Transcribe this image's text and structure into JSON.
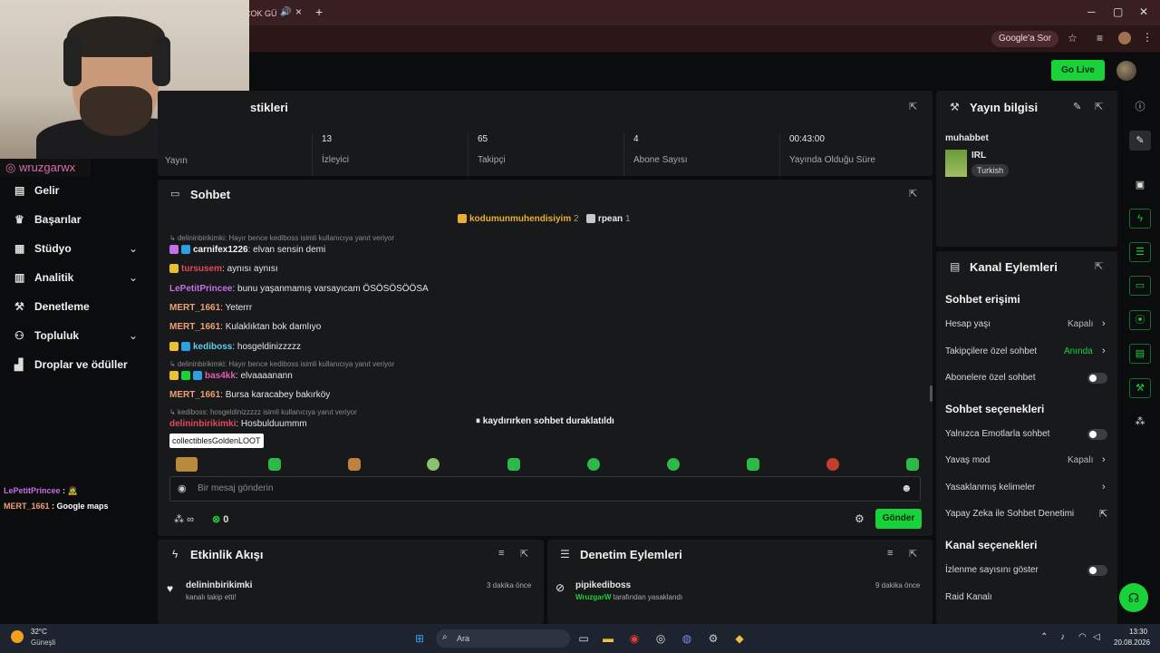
{
  "browser": {
    "tab_title": "ÇOK GÜ",
    "tab_audio_icon": "speaker-icon",
    "tab_close": "×",
    "new_tab": "+",
    "google_sor": "Google'a Sor",
    "win_min": "─",
    "win_max": "▢",
    "win_close": "✕"
  },
  "webcam": {
    "instagram_handle": "wruzgarwx"
  },
  "topbar": {
    "go_live": "Go Live"
  },
  "sidebar": {
    "items": [
      {
        "label": "Gelir",
        "icon": "income-icon"
      },
      {
        "label": "Başarılar",
        "icon": "trophy-icon"
      },
      {
        "label": "Stüdyo",
        "icon": "studio-icon"
      },
      {
        "label": "Analitik",
        "icon": "analytics-icon"
      },
      {
        "label": "Denetleme",
        "icon": "moderation-icon"
      },
      {
        "label": "Topluluk",
        "icon": "community-icon"
      },
      {
        "label": "Droplar ve ödüller",
        "icon": "drops-icon"
      }
    ]
  },
  "external_chat": [
    {
      "user": "LePetitPrincee",
      "sep": " : ",
      "text": "🧟"
    },
    {
      "user": "MERT_1661",
      "sep": " : ",
      "text": "Google maps"
    }
  ],
  "stats_panel": {
    "title": "stikleri",
    "stats": [
      {
        "value": "",
        "label": "Yayın"
      },
      {
        "value": "13",
        "label": "İzleyici"
      },
      {
        "value": "65",
        "label": "Takipçi"
      },
      {
        "value": "4",
        "label": "Abone Sayısı"
      },
      {
        "value": "00:43:00",
        "label": "Yayında Olduğu Süre"
      }
    ]
  },
  "chat": {
    "title": "Sohbet",
    "pinned": [
      {
        "user": "kodumunmuhendisiyim",
        "count": "2"
      },
      {
        "user": "rpean",
        "count": "1"
      }
    ],
    "messages": [
      {
        "reply": "delininbirikimki: Hayır bence kediboss isimli kullanıcıya yanıt veriyor"
      },
      {
        "user": "carnifex1226",
        "text": ": elvan sensin demi",
        "color": "#f2f2f2"
      },
      {
        "user": "tursusem",
        "text": ": aynısı aynısı",
        "color": "#e04a5b"
      },
      {
        "user": "LePetitPrincee",
        "text": ": bunu yaşanmamış varsayıcam ÖSÖSÖSÖÖSA",
        "color": "#c86ee8"
      },
      {
        "user": "MERT_1661",
        "text": ": Yeterrr",
        "color": "#f0a070"
      },
      {
        "user": "MERT_1661",
        "text": ": Kulaklıktan bok damlıyo",
        "color": "#f0a070"
      },
      {
        "user": "kediboss",
        "text": ": hosgeldinizzzzz",
        "color": "#5ad0e8"
      },
      {
        "reply": "delininbirikimki: Hayır bence kediboss isimli kullanıcıya yanıt veriyor"
      },
      {
        "user": "bas4kk",
        "text": ": elvaaaanann",
        "color": "#e85ab0"
      },
      {
        "user": "MERT_1661",
        "text": ": Bursa karacabey bakırköy",
        "color": "#f0a070"
      },
      {
        "reply": "kediboss: hosgeldinizzzzz isimli kullanıcıya yanıt veriyor"
      },
      {
        "user": "delininbirikimki",
        "text": ": Hosbulduummm",
        "color": "#e04a5b"
      }
    ],
    "paused_notice": "kaydırırken sohbet duraklatıldı",
    "tooltip": "collectiblesGoldenLOOT",
    "input_placeholder": "Bir mesaj gönderin",
    "points_label": "∞",
    "kick_points": "0",
    "send_label": "Gönder"
  },
  "activity": {
    "title": "Etkinlik Akışı",
    "items": [
      {
        "user": "delininbirikimki",
        "text": "kanalı takip etti!",
        "time": "3 dakika önce"
      }
    ]
  },
  "moderation": {
    "title": "Denetim Eylemleri",
    "items": [
      {
        "user": "pipikediboss",
        "by": "WruzgarW",
        "text": " tarafından yasaklandı",
        "time": "9 dakika önce"
      }
    ]
  },
  "stream_info": {
    "title": "Yayın bilgisi",
    "stream_title": "muhabbet",
    "category": "IRL",
    "language": "Turkish"
  },
  "channel_actions": {
    "title": "Kanal Eylemleri",
    "chat_access_head": "Sohbet erişimi",
    "account_age": {
      "label": "Hesap yaşı",
      "value": "Kapalı"
    },
    "followers_only": {
      "label": "Takipçilere özel sohbet",
      "value": "Anında"
    },
    "subs_only": {
      "label": "Abonelere özel sohbet"
    },
    "chat_options_head": "Sohbet seçenekleri",
    "emotes_only": {
      "label": "Yalnızca Emotlarla sohbet"
    },
    "slow_mode": {
      "label": "Yavaş mod",
      "value": "Kapalı"
    },
    "banned_words": {
      "label": "Yasaklanmış kelimeler"
    },
    "ai_moderation": {
      "label": "Yapay Zeka ile Sohbet Denetimi"
    },
    "channel_options_head": "Kanal seçenekleri",
    "show_views": {
      "label": "İzlenme sayısını göster"
    },
    "raid": {
      "label": "Raid Kanalı"
    }
  },
  "taskbar": {
    "temp": "32°C",
    "weather": "Güneşli",
    "search": "Ara",
    "time": "13:30",
    "date": "20.08.2026"
  },
  "colors": {
    "accent": "#19d23a",
    "panel": "#18191b",
    "bg": "#0b0c0d"
  }
}
